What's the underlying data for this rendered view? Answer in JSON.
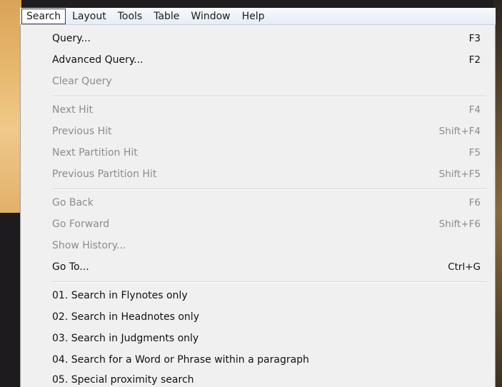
{
  "menubar": {
    "items": [
      {
        "label": "Search",
        "active": true
      },
      {
        "label": "Layout"
      },
      {
        "label": "Tools"
      },
      {
        "label": "Table"
      },
      {
        "label": "Window"
      },
      {
        "label": "Help"
      }
    ]
  },
  "menu": {
    "items": [
      {
        "label": "Query...",
        "shortcut": "F3",
        "enabled": true
      },
      {
        "label": "Advanced Query...",
        "shortcut": "F2",
        "enabled": true
      },
      {
        "label": "Clear Query",
        "shortcut": "",
        "enabled": false
      },
      {
        "label": "Next Hit",
        "shortcut": "F4",
        "enabled": false
      },
      {
        "label": "Previous Hit",
        "shortcut": "Shift+F4",
        "enabled": false
      },
      {
        "label": "Next Partition Hit",
        "shortcut": "F5",
        "enabled": false
      },
      {
        "label": "Previous Partition Hit",
        "shortcut": "Shift+F5",
        "enabled": false
      },
      {
        "label": "Go Back",
        "shortcut": "F6",
        "enabled": false
      },
      {
        "label": "Go Forward",
        "shortcut": "Shift+F6",
        "enabled": false
      },
      {
        "label": "Show History...",
        "shortcut": "",
        "enabled": false
      },
      {
        "label": "Go To...",
        "shortcut": "Ctrl+G",
        "enabled": true
      },
      {
        "label": "01. Search in Flynotes only",
        "shortcut": "",
        "enabled": true
      },
      {
        "label": "02. Search in Headnotes only",
        "shortcut": "",
        "enabled": true
      },
      {
        "label": "03. Search in Judgments only",
        "shortcut": "",
        "enabled": true
      },
      {
        "label": "04. Search for a Word or Phrase within a paragraph",
        "shortcut": "",
        "enabled": true
      },
      {
        "label": "05. Special proximity search",
        "shortcut": "",
        "enabled": true
      }
    ]
  }
}
